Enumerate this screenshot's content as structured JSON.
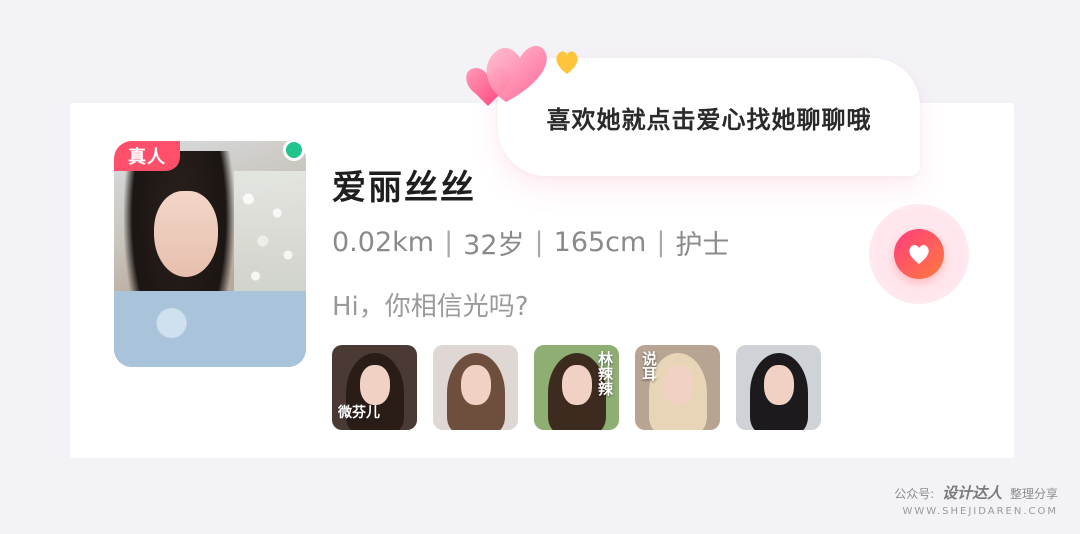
{
  "profile": {
    "badge": "真人",
    "name": "爱丽丝丝",
    "distance": "0.02km",
    "age": "32岁",
    "height": "165cm",
    "job": "护士",
    "separator": "|",
    "greeting": "Hi，你相信光吗?"
  },
  "gallery": [
    {
      "caption": "微芬儿",
      "side_caption": "",
      "bg": "#4a3a33",
      "hair": "#2a1d18"
    },
    {
      "caption": "",
      "side_caption": "",
      "bg": "#ded7d4",
      "hair": "#6e4e3d"
    },
    {
      "caption": "",
      "side_caption": "林辣辣",
      "bg": "#8fae74",
      "hair": "#3d2b20"
    },
    {
      "caption": "",
      "side_caption": "说耳",
      "bg": "#b8a493",
      "hair": "#e8d5b8"
    },
    {
      "caption": "",
      "side_caption": "",
      "bg": "#cfd2d6",
      "hair": "#1c1a1c"
    }
  ],
  "prompt_bubble": {
    "text": "喜欢她就点击爱心找她聊聊哦"
  },
  "like_button": {
    "icon": "heart-icon"
  },
  "watermark": {
    "prefix": "公众号:",
    "brand": "设计达人",
    "suffix": "整理分享",
    "url": "WWW.SHEJIDAREN.COM"
  },
  "colors": {
    "badge": "#ff4f6b",
    "online": "#1fc48e",
    "like_gradient_start": "#ff3d7f",
    "like_gradient_end": "#ff7a3c"
  }
}
